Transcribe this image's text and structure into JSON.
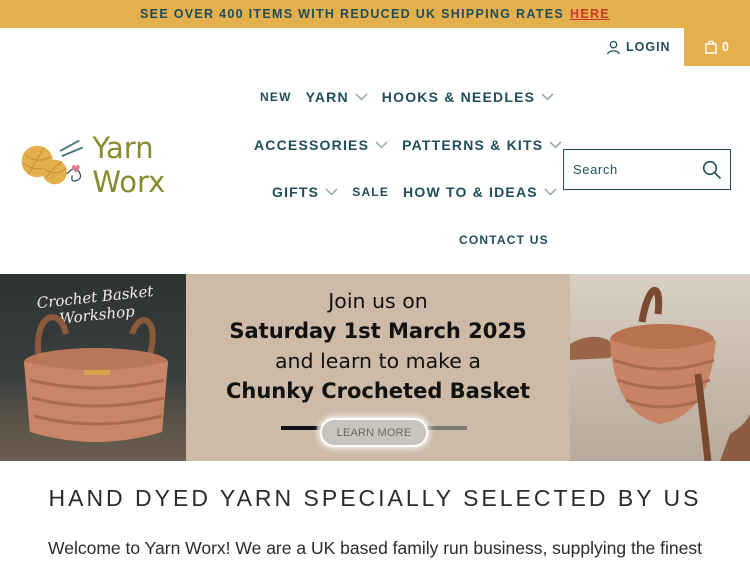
{
  "announcement": {
    "text": "SEE OVER 400 ITEMS WITH REDUCED UK SHIPPING RATES",
    "link": "HERE"
  },
  "utility": {
    "login_label": "LOGIN",
    "cart_count": "0"
  },
  "logo": {
    "text": "Yarn Worx"
  },
  "nav": {
    "new": "NEW",
    "yarn": "YARN",
    "hooks": "HOOKS & NEEDLES",
    "accessories": "ACCESSORIES",
    "patterns": "PATTERNS & KITS",
    "gifts": "GIFTS",
    "sale": "SALE",
    "howto": "HOW TO & IDEAS",
    "contact": "CONTACT US"
  },
  "search": {
    "placeholder": "Search"
  },
  "banner": {
    "workshop_line1": "Crochet Basket",
    "workshop_line2": "Workshop",
    "line1": "Join us on",
    "line2": "Saturday 1st March 2025",
    "line3": "and learn to make a",
    "line4": "Chunky Crocheted Basket",
    "button": "LEARN MORE"
  },
  "section": {
    "heading": "HAND DYED YARN SPECIALLY SELECTED BY US",
    "intro": "Welcome to Yarn Worx! We are a UK based family run business, supplying the finest"
  },
  "colors": {
    "accent": "#e4b04d",
    "text": "#1f4e5a",
    "link_red": "#c8372d",
    "banner_beige": "#cdbba8"
  }
}
